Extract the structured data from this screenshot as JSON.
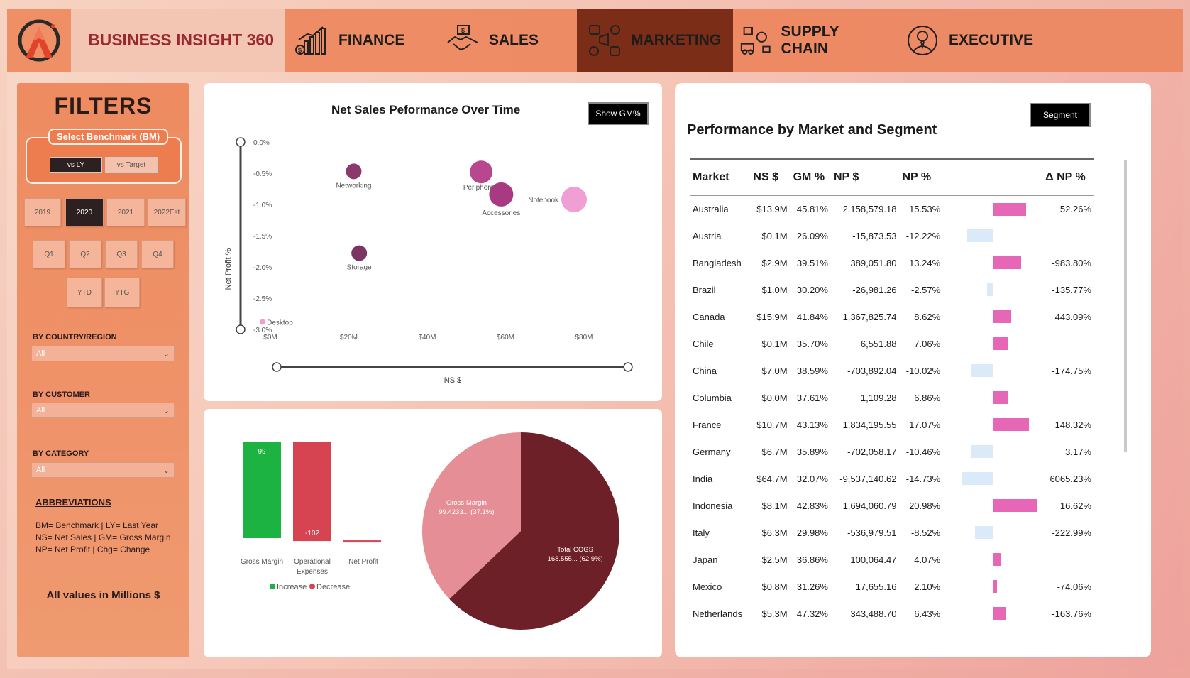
{
  "brand": {
    "title": "BUSINESS INSIGHT 360"
  },
  "nav": {
    "items": [
      {
        "label": "FINANCE",
        "icon": "finance-chart-icon"
      },
      {
        "label": "SALES",
        "icon": "handshake-icon"
      },
      {
        "label": "MARKETING",
        "icon": "marketing-icon"
      },
      {
        "label": "SUPPLY CHAIN",
        "icon": "supply-chain-icon"
      },
      {
        "label": "EXECUTIVE",
        "icon": "executive-icon"
      }
    ],
    "active": "MARKETING"
  },
  "filters": {
    "title": "FILTERS",
    "benchmark_label": "Select Benchmark (BM)",
    "benchmark_options": [
      "vs LY",
      "vs Target"
    ],
    "benchmark_selected": "vs LY",
    "years": [
      "2019",
      "2020",
      "2021",
      "2022Est"
    ],
    "year_selected": "2020",
    "quarters": [
      "Q1",
      "Q2",
      "Q3",
      "Q4"
    ],
    "periods": [
      "YTD",
      "YTG"
    ],
    "country_label": "BY COUNTRY/REGION",
    "country_value": "All",
    "customer_label": "BY CUSTOMER",
    "customer_value": "All",
    "category_label": "BY CATEGORY",
    "category_value": "All",
    "abbr_title": "ABBREVIATIONS",
    "abbr_lines": [
      "BM= Benchmark | LY= Last Year",
      "NS= Net Sales | GM= Gross Margin",
      "NP= Net Profit | Chg= Change"
    ],
    "all_values": "All values in Millions $"
  },
  "scatter": {
    "title": "Net Sales Peformance Over Time",
    "button": "Show GM%"
  },
  "chart_data": [
    {
      "type": "scatter",
      "xlabel": "NS $",
      "ylabel": "Net Profit %",
      "x_ticks": [
        "$0M",
        "$20M",
        "$40M",
        "$60M",
        "$80M"
      ],
      "y_ticks": [
        "0.0%",
        "-0.5%",
        "-1.0%",
        "-1.5%",
        "-2.0%",
        "-2.5%",
        "-3.0%"
      ],
      "xlim": [
        0,
        90
      ],
      "ylim": [
        -3.0,
        0
      ],
      "points": [
        {
          "label": "Networking",
          "x": 26,
          "y": -0.47,
          "size": 11,
          "color": "#8b3a6b"
        },
        {
          "label": "Peripherals",
          "x": 61,
          "y": -0.48,
          "size": 16,
          "color": "#b8478e"
        },
        {
          "label": "Accessories",
          "x": 66.5,
          "y": -0.84,
          "size": 17,
          "color": "#a83a82"
        },
        {
          "label": "Notebook",
          "x": 86.5,
          "y": -0.92,
          "size": 18,
          "color": "#ef9fd4"
        },
        {
          "label": "Storage",
          "x": 27.5,
          "y": -1.78,
          "size": 11,
          "color": "#7a3563"
        },
        {
          "label": "Desktop",
          "x": 1,
          "y": -2.88,
          "size": 4,
          "color": "#ef9fd4"
        }
      ]
    },
    {
      "type": "bar",
      "categories": [
        "Gross Margin",
        "Operational Expenses",
        "Net Profit"
      ],
      "values": [
        99,
        -102,
        -3
      ],
      "data_labels": [
        "99",
        "-102",
        ""
      ],
      "legend": [
        {
          "name": "Increase",
          "color": "#1db342"
        },
        {
          "name": "Decrease",
          "color": "#d64452"
        }
      ]
    },
    {
      "type": "pie",
      "slices": [
        {
          "name": "Gross Margin",
          "label": "99.4233... (37.1%)",
          "value": 37.1,
          "color": "#e68e96"
        },
        {
          "name": "Total COGS",
          "label": "168.555... (62.9%)",
          "value": 62.9,
          "color": "#6d2028"
        }
      ]
    }
  ],
  "market_table": {
    "title": "Performance by Market and Segment",
    "button": "Segment",
    "headers": [
      "Market",
      "NS $",
      "GM %",
      "NP $",
      "NP %",
      "",
      "Δ NP %"
    ],
    "rows": [
      {
        "market": "Australia",
        "ns": "$13.9M",
        "gm": "45.81%",
        "np": "2,158,579.18",
        "npp": "15.53%",
        "bar": 15.53,
        "dnp": "52.26%"
      },
      {
        "market": "Austria",
        "ns": "$0.1M",
        "gm": "26.09%",
        "np": "-15,873.53",
        "npp": "-12.22%",
        "bar": -12.22,
        "dnp": ""
      },
      {
        "market": "Bangladesh",
        "ns": "$2.9M",
        "gm": "39.51%",
        "np": "389,051.80",
        "npp": "13.24%",
        "bar": 13.24,
        "dnp": "-983.80%"
      },
      {
        "market": "Brazil",
        "ns": "$1.0M",
        "gm": "30.20%",
        "np": "-26,981.26",
        "npp": "-2.57%",
        "bar": -2.57,
        "dnp": "-135.77%"
      },
      {
        "market": "Canada",
        "ns": "$15.9M",
        "gm": "41.84%",
        "np": "1,367,825.74",
        "npp": "8.62%",
        "bar": 8.62,
        "dnp": "443.09%"
      },
      {
        "market": "Chile",
        "ns": "$0.1M",
        "gm": "35.70%",
        "np": "6,551.88",
        "npp": "7.06%",
        "bar": 7.06,
        "dnp": ""
      },
      {
        "market": "China",
        "ns": "$7.0M",
        "gm": "38.59%",
        "np": "-703,892.04",
        "npp": "-10.02%",
        "bar": -10.02,
        "dnp": "-174.75%"
      },
      {
        "market": "Columbia",
        "ns": "$0.0M",
        "gm": "37.61%",
        "np": "1,109.28",
        "npp": "6.86%",
        "bar": 6.86,
        "dnp": ""
      },
      {
        "market": "France",
        "ns": "$10.7M",
        "gm": "43.13%",
        "np": "1,834,195.55",
        "npp": "17.07%",
        "bar": 17.07,
        "dnp": "148.32%"
      },
      {
        "market": "Germany",
        "ns": "$6.7M",
        "gm": "35.89%",
        "np": "-702,058.17",
        "npp": "-10.46%",
        "bar": -10.46,
        "dnp": "3.17%"
      },
      {
        "market": "India",
        "ns": "$64.7M",
        "gm": "32.07%",
        "np": "-9,537,140.62",
        "npp": "-14.73%",
        "bar": -14.73,
        "dnp": "6065.23%"
      },
      {
        "market": "Indonesia",
        "ns": "$8.1M",
        "gm": "42.83%",
        "np": "1,694,060.79",
        "npp": "20.98%",
        "bar": 20.98,
        "dnp": "16.62%"
      },
      {
        "market": "Italy",
        "ns": "$6.3M",
        "gm": "29.98%",
        "np": "-536,979.51",
        "npp": "-8.52%",
        "bar": -8.52,
        "dnp": "-222.99%"
      },
      {
        "market": "Japan",
        "ns": "$2.5M",
        "gm": "36.86%",
        "np": "100,064.47",
        "npp": "4.07%",
        "bar": 4.07,
        "dnp": ""
      },
      {
        "market": "Mexico",
        "ns": "$0.8M",
        "gm": "31.26%",
        "np": "17,655.16",
        "npp": "2.10%",
        "bar": 2.1,
        "dnp": "-74.06%"
      },
      {
        "market": "Netherlands",
        "ns": "$5.3M",
        "gm": "47.32%",
        "np": "343,488.70",
        "npp": "6.43%",
        "bar": 6.43,
        "dnp": "-163.76%"
      }
    ]
  }
}
